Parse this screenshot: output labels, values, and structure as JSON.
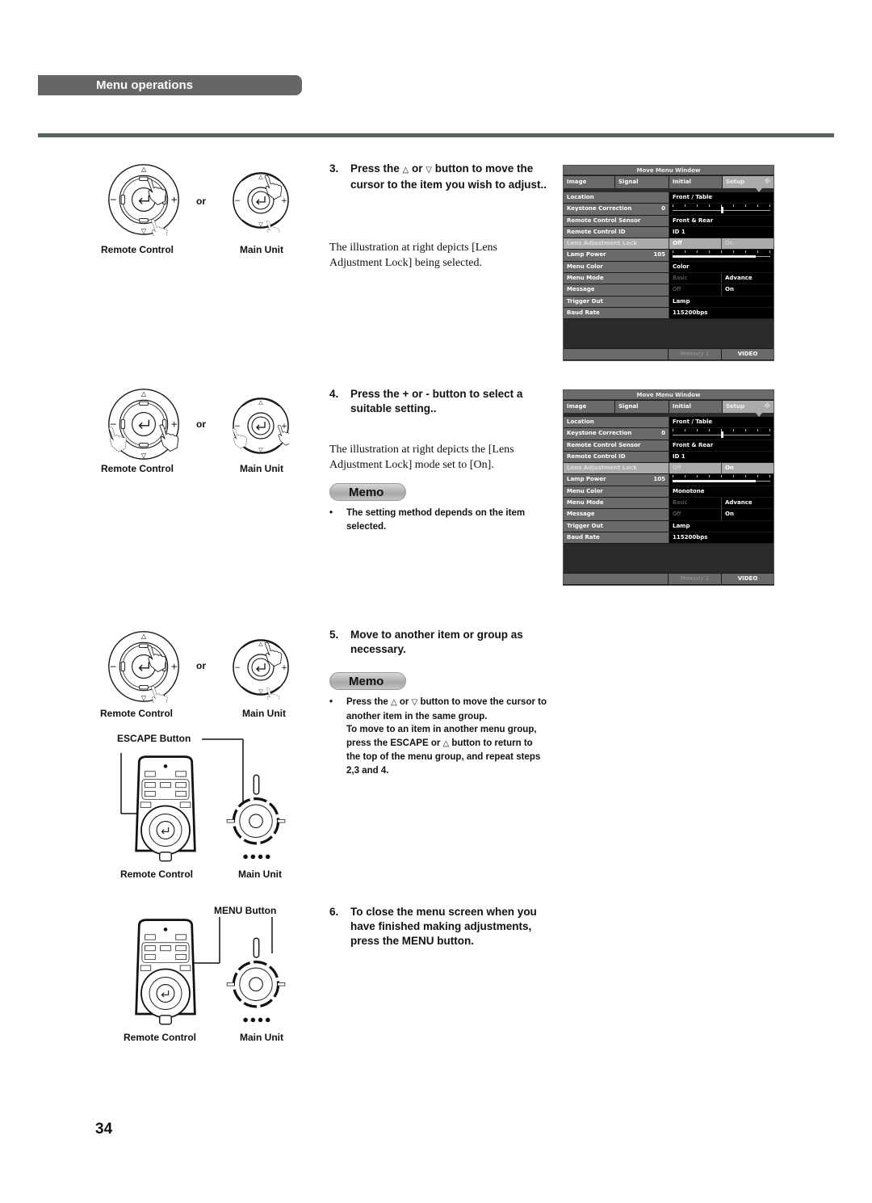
{
  "section": {
    "title": "Menu operations"
  },
  "page_number": "34",
  "labels": {
    "or": "or",
    "remote_control": "Remote Control",
    "main_unit": "Main Unit",
    "escape_button": "ESCAPE Button",
    "menu_button": "MENU Button"
  },
  "steps": [
    {
      "num": "3.",
      "text_a": "Press the ",
      "up_icon": "△",
      "text_b": " or ",
      "down_icon": "▽",
      "text_c": " button to move the cursor to the item you wish to adjust..",
      "description": "The illustration at right depicts [Lens Adjustment Lock] being selected."
    },
    {
      "num": "4.",
      "text": "Press the + or - button to select a suitable setting..",
      "description": "The illustration at right depicts the  [Lens Adjustment Lock] mode set to [On].",
      "memo_label": "Memo",
      "memo_bullets": [
        "The setting method depends on the item selected."
      ]
    },
    {
      "num": "5.",
      "text": "Move to another item or group as necessary.",
      "memo_label": "Memo",
      "memo_a": "Press the ",
      "memo_up": "△",
      "memo_b": " or ",
      "memo_down": "▽",
      "memo_c": " button to move the cursor to another item in the same group.",
      "memo_d": "To move to an item in another menu group, press the ESCAPE or ",
      "memo_up2": "△",
      "memo_e": " button to return to the top of the menu group, and repeat steps 2,3 and 4."
    },
    {
      "num": "6.",
      "text": "To close the menu screen when you have finished making adjustments, press the MENU button."
    }
  ],
  "osd_screens": [
    {
      "title": "Move Menu Window",
      "tabs": [
        "Image",
        "Signal",
        "Initial",
        "Setup"
      ],
      "selected_tab": "Setup",
      "move_icon": "✥",
      "rows": {
        "location": {
          "label": "Location",
          "value": "Front / Table"
        },
        "keystone": {
          "label": "Keystone Correction",
          "number": "0",
          "slider_fraction": 0.5
        },
        "rc_sensor": {
          "label": "Remote Control Sensor",
          "value": "Front & Rear"
        },
        "rc_id": {
          "label": "Remote Control ID",
          "value": "ID 1"
        },
        "lens_lock": {
          "label": "Lens Adjustment Lock",
          "opt1": "Off",
          "opt2": "On",
          "selected": "Off"
        },
        "lamp_power": {
          "label": "Lamp Power",
          "number": "105",
          "slider_fraction": 0.85
        },
        "menu_color": {
          "label": "Menu Color",
          "value": "Color"
        },
        "menu_mode": {
          "label": "Menu Mode",
          "opt1": "Basic",
          "opt2": "Advance"
        },
        "message": {
          "label": "Message",
          "opt1": "Off",
          "opt2": "On"
        },
        "trigger_out": {
          "label": "Trigger Out",
          "value": "Lamp"
        },
        "baud_rate": {
          "label": "Baud Rate",
          "value": "115200bps"
        }
      },
      "footer": {
        "memory": "Memory 1",
        "source": "VIDEO"
      }
    },
    {
      "title": "Move Menu Window",
      "tabs": [
        "Image",
        "Signal",
        "Initial",
        "Setup"
      ],
      "selected_tab": "Setup",
      "move_icon": "✥",
      "rows": {
        "location": {
          "label": "Location",
          "value": "Front / Table"
        },
        "keystone": {
          "label": "Keystone Correction",
          "number": "0",
          "slider_fraction": 0.5
        },
        "rc_sensor": {
          "label": "Remote Control Sensor",
          "value": "Front & Rear"
        },
        "rc_id": {
          "label": "Remote Control ID",
          "value": "ID 1"
        },
        "lens_lock": {
          "label": "Lens Adjustment Lock",
          "opt1": "Off",
          "opt2": "On",
          "selected": "On"
        },
        "lamp_power": {
          "label": "Lamp Power",
          "number": "105",
          "slider_fraction": 0.85
        },
        "menu_color": {
          "label": "Menu Color",
          "value": "Monotone"
        },
        "menu_mode": {
          "label": "Menu Mode",
          "opt1": "Basic",
          "opt2": "Advance"
        },
        "message": {
          "label": "Message",
          "opt1": "Off",
          "opt2": "On"
        },
        "trigger_out": {
          "label": "Trigger Out",
          "value": "Lamp"
        },
        "baud_rate": {
          "label": "Baud Rate",
          "value": "115200bps"
        }
      },
      "footer": {
        "memory": "Memory 1",
        "source": "VIDEO"
      }
    }
  ]
}
